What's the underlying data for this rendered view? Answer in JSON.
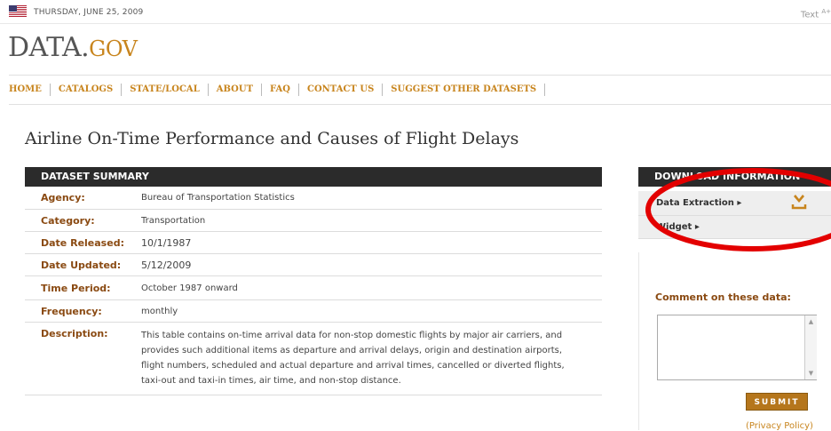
{
  "header": {
    "date": "THURSDAY, JUNE 25, 2009",
    "text_size_label": "Text",
    "text_size_sup": "A+",
    "logo_main": "DATA.",
    "logo_gov": "GOV"
  },
  "nav": {
    "items": [
      "HOME",
      "CATALOGS",
      "STATE/LOCAL",
      "ABOUT",
      "FAQ",
      "CONTACT US",
      "SUGGEST OTHER DATASETS"
    ]
  },
  "page_title": "Airline On-Time Performance and Causes of Flight Delays",
  "summary": {
    "header": "DATASET SUMMARY",
    "rows": [
      {
        "label": "Agency:",
        "value": "Bureau of Transportation Statistics"
      },
      {
        "label": "Category:",
        "value": "Transportation"
      },
      {
        "label": "Date Released:",
        "value": "10/1/1987"
      },
      {
        "label": "Date Updated:",
        "value": "5/12/2009"
      },
      {
        "label": "Time Period:",
        "value": "October 1987 onward"
      },
      {
        "label": "Frequency:",
        "value": "monthly"
      },
      {
        "label": "Description:",
        "value": "This table contains on-time arrival data for non-stop domestic flights by major air carriers, and provides such additional items as departure and arrival delays, origin and destination airports, flight numbers, scheduled and actual departure and arrival times, cancelled or diverted flights, taxi-out and taxi-in times, air time, and non-stop distance."
      }
    ]
  },
  "sidebar": {
    "header": "DOWNLOAD INFORMATION",
    "data_extraction": "Data Extraction ▸",
    "widget": "Widget ▸",
    "comment_label": "Comment on these data:",
    "comment_value": "",
    "submit_label": "SUBMIT",
    "privacy": "(Privacy Policy)"
  },
  "colors": {
    "accent": "#c8851e",
    "label": "#8a4a12",
    "header_bg": "#2b2b2b",
    "highlight_ellipse": "#e30000"
  },
  "icons": {
    "flag": "us-flag-icon",
    "download": "download-arrow-icon"
  }
}
